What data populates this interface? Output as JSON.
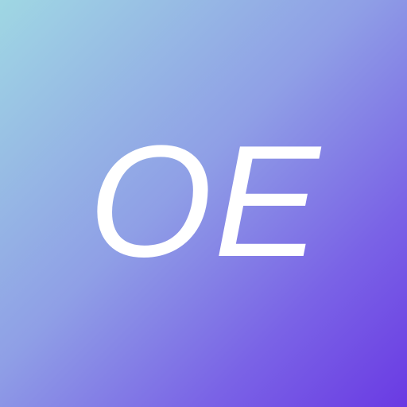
{
  "avatar": {
    "initials": "OE",
    "text_color": "#ffffff",
    "gradient_colors": [
      "#9fd7e3",
      "#8f9fe6",
      "#7a63e6",
      "#6a3ae3"
    ]
  }
}
